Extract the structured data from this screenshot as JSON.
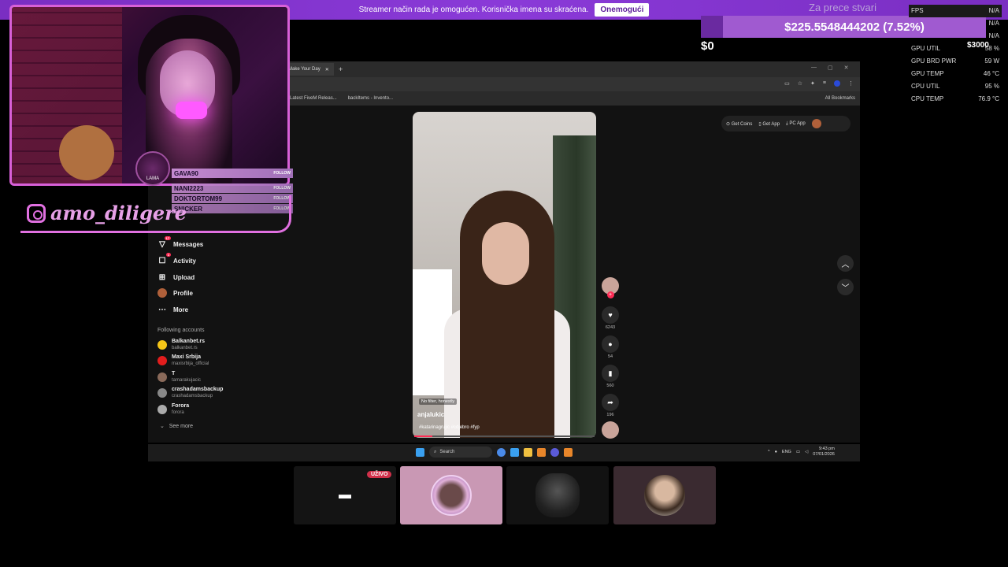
{
  "banner": {
    "text": "Streamer način rada je omogućen. Korisnička imena su skraćena.",
    "button": "Onemogući"
  },
  "overlay": {
    "instagram_handle": "amo_diligere",
    "logo_text": "LAMA",
    "followers": [
      {
        "name": "GAVA90",
        "action": "FOLLOW"
      },
      {
        "name": "NANI2223",
        "action": "FOLLOW"
      },
      {
        "name": "DOKTORTOM99",
        "action": "FOLLOW"
      },
      {
        "name": "SNICKER",
        "action": "FOLLOW"
      }
    ]
  },
  "goal": {
    "title": "Za prece stvari",
    "amount": "$225.5548444202 (7.52%)",
    "min": "$0",
    "max": "$3000",
    "progress_fraction": 0.0752
  },
  "stats": [
    {
      "label": "FPS",
      "value": "N/A"
    },
    {
      "label": "",
      "value": "N/A"
    },
    {
      "label": "",
      "value": "N/A"
    },
    {
      "label": "GPU UTIL",
      "value": "58 %"
    },
    {
      "label": "GPU BRD PWR",
      "value": "59 W"
    },
    {
      "label": "GPU TEMP",
      "value": "46 °C"
    },
    {
      "label": "CPU UTIL",
      "value": "95 %"
    },
    {
      "label": "CPU TEMP",
      "value": "76.9 °C"
    }
  ],
  "browser": {
    "tab": "Make Your Day",
    "bookmarks": [
      "Latest FiveM Releas...",
      "backItems - Invento..."
    ],
    "all_bookmarks": "All Bookmarks"
  },
  "tiktok": {
    "nav": [
      {
        "label": "Messages",
        "badge": "17"
      },
      {
        "label": "Activity",
        "badge": "1"
      },
      {
        "label": "Upload",
        "badge": ""
      },
      {
        "label": "Profile",
        "badge": ""
      },
      {
        "label": "More",
        "badge": ""
      }
    ],
    "following_title": "Following accounts",
    "accounts": [
      {
        "name": "Balkanbet.rs",
        "handle": "balkanbet.rs",
        "color": "#f5c518"
      },
      {
        "name": "Maxi Srbija",
        "handle": "maxisrbija_official",
        "color": "#e31d1d"
      },
      {
        "name": "T",
        "handle": "tamarakujacic",
        "color": "#8a6a5a"
      },
      {
        "name": "crashadamsbackup",
        "handle": "crashadamsbackup",
        "color": "#888888"
      },
      {
        "name": "Forora",
        "handle": "forora",
        "color": "#aaaaaa"
      }
    ],
    "see_more": "See more",
    "top_buttons": [
      "Get Coins",
      "Get App",
      "PC App"
    ],
    "video": {
      "tag": "No filter, honestly",
      "username": "anjalukic",
      "caption": "#katarinagrujic #cdjebro #fyp",
      "progress_fraction": 0.1
    },
    "actions": [
      {
        "icon": "heart-icon",
        "count": "6243"
      },
      {
        "icon": "comment-icon",
        "count": "54"
      },
      {
        "icon": "bookmark-icon",
        "count": "560"
      },
      {
        "icon": "share-icon",
        "count": "196"
      }
    ]
  },
  "taskbar": {
    "search": "Search",
    "lang": "ENG",
    "time": "9:43 pm",
    "date": "07/01/2026"
  },
  "live_badge": "UŽIVO"
}
